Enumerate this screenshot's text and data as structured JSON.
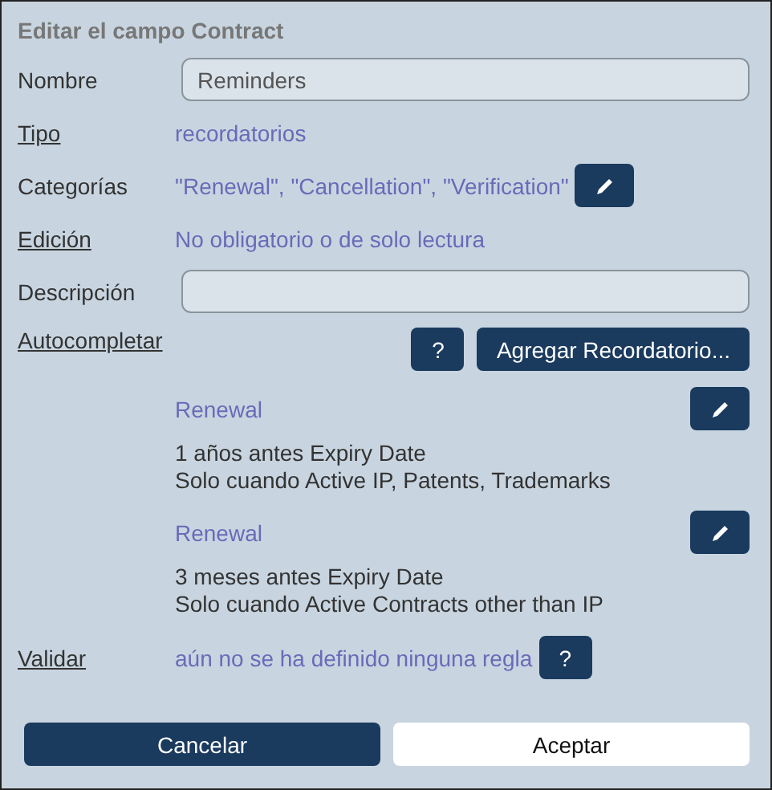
{
  "title": "Editar el campo Contract",
  "fields": [
    {
      "label": "Nombre",
      "label_link": false,
      "kind": "input",
      "value": "Reminders"
    },
    {
      "label": "Tipo",
      "label_link": true,
      "kind": "text",
      "value": "recordatorios"
    },
    {
      "label": "Categorías",
      "label_link": false,
      "kind": "text_edit",
      "value": "\"Renewal\", \"Cancellation\", \"Verification\""
    },
    {
      "label": "Edición",
      "label_link": true,
      "kind": "text",
      "value": "No obligatorio o de solo lectura"
    },
    {
      "label": "Descripción",
      "label_link": false,
      "kind": "input"
    },
    {
      "label": "Autocompletar",
      "label_link": true,
      "kind": "reminders",
      "help": "?",
      "add": "Agregar Recordatorio...",
      "reminders": [
        {
          "title": "Renewal",
          "lines": [
            "1 años antes Expiry Date",
            "Solo cuando Active IP, Patents, Trademarks"
          ]
        },
        {
          "title": "Renewal",
          "lines": [
            "3 meses antes Expiry Date",
            "Solo cuando Active Contracts other than IP"
          ]
        }
      ]
    },
    {
      "label": "Validar",
      "label_link": true,
      "kind": "text_help",
      "value": "aún no se ha definido ninguna regla",
      "help": "?"
    }
  ],
  "buttons": [
    {
      "label": "Cancelar",
      "kind": "secondary"
    },
    {
      "label": "Aceptar",
      "kind": "primary"
    }
  ]
}
